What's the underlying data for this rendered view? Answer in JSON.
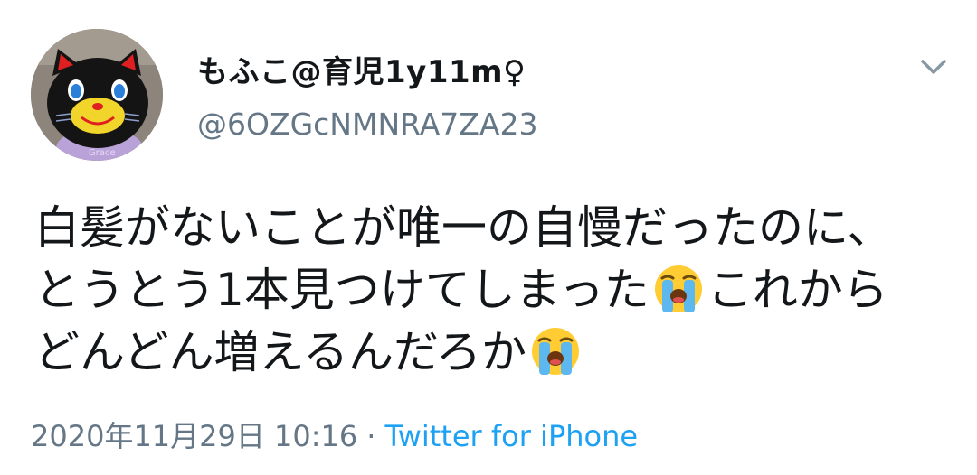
{
  "user": {
    "display_name": "もふこ@育児1y11m♀",
    "handle": "@6OZGcNMNRA7ZA23"
  },
  "tweet": {
    "line1": "白髪がないことが唯一の自慢だったのに、",
    "line2_text": "とうとう1本見つけてしまった",
    "line2_after": "これから",
    "line3_text": "どんどん増えるんだろか",
    "emoji": "loudly-crying-face-icon"
  },
  "meta": {
    "timestamp": "2020年11月29日 10:16",
    "separator": "·",
    "source": "Twitter for iPhone"
  },
  "colors": {
    "text": "#14171a",
    "secondary": "#657786",
    "link": "#1da1f2"
  }
}
